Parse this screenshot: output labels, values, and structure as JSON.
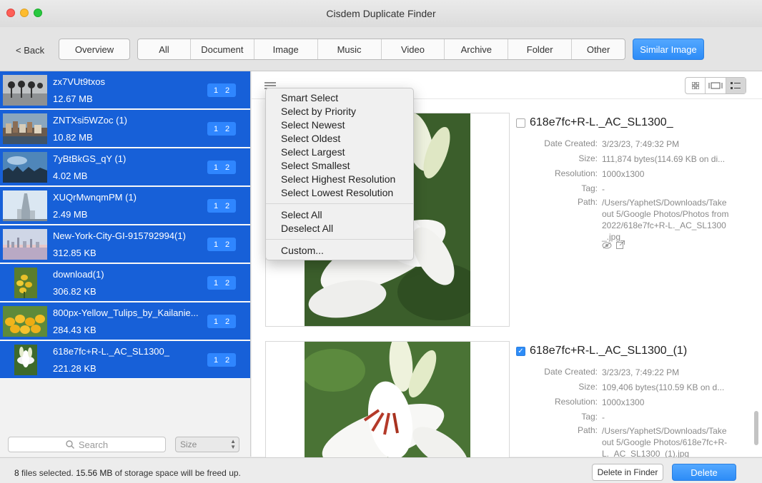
{
  "window": {
    "title": "Cisdem Duplicate Finder"
  },
  "toolbar": {
    "back_label": "< Back",
    "overview_label": "Overview",
    "tabs": [
      "All",
      "Document",
      "Image",
      "Music",
      "Video",
      "Archive",
      "Folder",
      "Other"
    ],
    "similar_image_label": "Similar Image"
  },
  "groups": [
    {
      "name": "zx7VUt9txos",
      "size": "12.67 MB",
      "badge": [
        "1",
        "2"
      ]
    },
    {
      "name": "ZNTXsi5WZoc (1)",
      "size": "10.82 MB",
      "badge": [
        "1",
        "2"
      ]
    },
    {
      "name": "7yBtBkGS_qY (1)",
      "size": "4.02 MB",
      "badge": [
        "1",
        "2"
      ]
    },
    {
      "name": "XUQrMwnqmPM (1)",
      "size": "2.49 MB",
      "badge": [
        "1",
        "2"
      ]
    },
    {
      "name": "New-York-City-GI-915792994(1)",
      "size": "312.85 KB",
      "badge": [
        "1",
        "2"
      ]
    },
    {
      "name": "download(1)",
      "size": "306.82 KB",
      "badge": [
        "1",
        "2"
      ]
    },
    {
      "name": "800px-Yellow_Tulips_by_Kailanie...",
      "size": "284.43 KB",
      "badge": [
        "1",
        "2"
      ]
    },
    {
      "name": "618e7fc+R-L._AC_SL1300_",
      "size": "221.28 KB",
      "badge": [
        "1",
        "2"
      ]
    }
  ],
  "sidebar_footer": {
    "search_placeholder": "Search",
    "sort_value": "Size"
  },
  "menu": {
    "items_a": [
      "Smart Select",
      "Select by Priority",
      "Select Newest",
      "Select Oldest",
      "Select Largest",
      "Select Smallest",
      "Select Highest Resolution",
      "Select Lowest Resolution"
    ],
    "items_b": [
      "Select All",
      "Deselect All"
    ],
    "items_c": [
      "Custom..."
    ]
  },
  "labels": {
    "date": "Date Created:",
    "size": "Size:",
    "resolution": "Resolution:",
    "tag": "Tag:",
    "path": "Path:"
  },
  "files": [
    {
      "name": "618e7fc+R-L._AC_SL1300_",
      "checked": false,
      "date": "3/23/23, 7:49:32 PM",
      "size": "111,874 bytes(114.69 KB on di...",
      "resolution": "1000x1300",
      "tag": "-",
      "path": "/Users/YaphetS/Downloads/Takeout 5/Google Photos/Photos from 2022/618e7fc+R-L._AC_SL1300_.jpg"
    },
    {
      "name": "618e7fc+R-L._AC_SL1300_(1)",
      "checked": true,
      "date": "3/23/23, 7:49:22 PM",
      "size": "109,406 bytes(110.59 KB on d...",
      "resolution": "1000x1300",
      "tag": "-",
      "path": "/Users/YaphetS/Downloads/Takeout 5/Google Photos/618e7fc+R-L._AC_SL1300_(1).jpg"
    }
  ],
  "status": {
    "count": "8",
    "text1": " files selected. ",
    "amount": "15.56 MB",
    "text2": " of storage space will be freed up.",
    "delete_finder_label": "Delete in Finder",
    "delete_label": "Delete"
  },
  "colors": {
    "selection": "#1760d8",
    "accent": "#2d8cf7"
  },
  "icons": {
    "menu": "list-lines-icon",
    "search": "magnifier-icon",
    "preview": "eye-icon",
    "reveal": "open-external-icon"
  }
}
